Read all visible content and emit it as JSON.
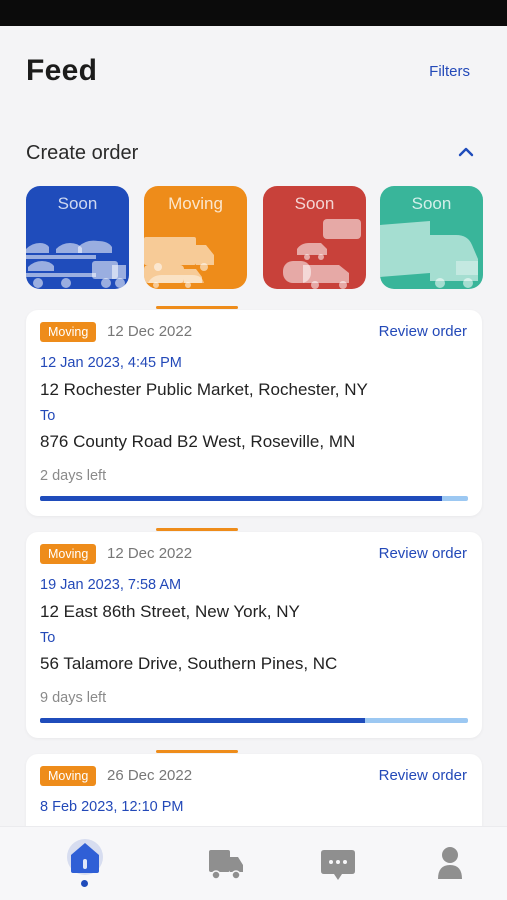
{
  "header": {
    "title": "Feed",
    "filters_label": "Filters"
  },
  "create_order": {
    "title": "Create order",
    "categories": [
      {
        "label": "Soon",
        "color": "#1f4cbb",
        "icon": "car-carrier-icon"
      },
      {
        "label": "Moving",
        "color": "#ee8c1a",
        "icon": "moving-van-icon"
      },
      {
        "label": "Soon",
        "color": "#c8413a",
        "icon": "rv-trailer-icon"
      },
      {
        "label": "Soon",
        "color": "#39b59a",
        "icon": "semi-truck-icon"
      }
    ]
  },
  "orders": [
    {
      "badge": "Moving",
      "date": "12 Dec 2022",
      "review_label": "Review order",
      "pickup_time": "12 Jan 2023, 4:45 PM",
      "from": "12 Rochester Public Market, Rochester, NY",
      "to_label": "To",
      "to": "876 County Road B2 West, Roseville, MN",
      "days_left": "2 days left",
      "progress": 0.94
    },
    {
      "badge": "Moving",
      "date": "12 Dec 2022",
      "review_label": "Review order",
      "pickup_time": "19 Jan 2023, 7:58 AM",
      "from": "12 East 86th Street, New York, NY",
      "to_label": "To",
      "to": "56 Talamore Drive, Southern Pines, NC",
      "days_left": "9 days left",
      "progress": 0.76
    },
    {
      "badge": "Moving",
      "date": "26 Dec 2022",
      "review_label": "Review order",
      "pickup_time": "8 Feb 2023, 12:10 PM"
    }
  ],
  "nav": {
    "items": [
      {
        "icon": "home-icon",
        "active": true
      },
      {
        "icon": "truck-icon",
        "active": false
      },
      {
        "icon": "chat-icon",
        "active": false
      },
      {
        "icon": "profile-icon",
        "active": false
      }
    ],
    "accent": "#1f4cbb"
  }
}
